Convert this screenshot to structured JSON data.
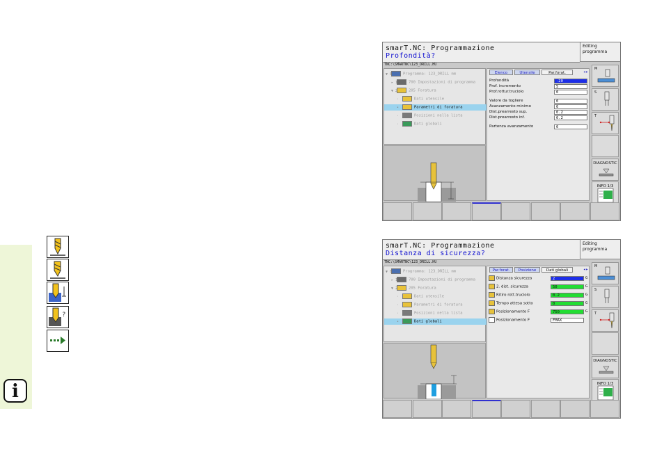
{
  "legend_icons": [
    {
      "name": "depth-drilling-icon"
    },
    {
      "name": "drill-icon"
    },
    {
      "name": "drill-feed-icon"
    },
    {
      "name": "drill-chip-icon"
    },
    {
      "name": "approach-arrow-icon"
    }
  ],
  "info_icon": {
    "glyph": "i"
  },
  "screens": [
    {
      "title": "smarT.NC: Programmazione",
      "subtitle": "Profondità?",
      "mode": [
        "Editing",
        "programma"
      ],
      "path": "TNC:\\SMARTNC\\123_DRILL.HU",
      "tree": [
        {
          "arrow": "▼ 0",
          "label": "Programma: 123_DRILL mm",
          "selected": false,
          "indent": 0
        },
        {
          "arrow": "▸ 1",
          "label": "700 Impostazioni di programma",
          "selected": false,
          "indent": 1
        },
        {
          "arrow": "▼ 2",
          "label": "205 Foratura",
          "selected": false,
          "indent": 1
        },
        {
          "arrow": "·",
          "label": "Dati utensile",
          "selected": false,
          "indent": 2
        },
        {
          "arrow": "•",
          "label": "Parametri di foratura",
          "selected": true,
          "indent": 2
        },
        {
          "arrow": "·",
          "label": "Posizioni nella lista",
          "selected": false,
          "indent": 2
        },
        {
          "arrow": "·",
          "label": "Dati globali",
          "selected": false,
          "indent": 2
        }
      ],
      "tabs": [
        {
          "label": "Elenco",
          "active": false
        },
        {
          "label": "Utensile",
          "active": false
        },
        {
          "label": "Par.forat.",
          "active": true
        }
      ],
      "fields": [
        {
          "label": "Profondità",
          "value": "-20",
          "highlight": true,
          "icon": false,
          "unit": ""
        },
        {
          "label": "Prof. incremento",
          "value": "5",
          "highlight": false,
          "icon": false,
          "unit": ""
        },
        {
          "label": "Prof.rottur.truciolo",
          "value": "0",
          "highlight": false,
          "icon": false,
          "unit": ""
        },
        {
          "label": "Valore da togliere",
          "value": "0",
          "highlight": false,
          "icon": false,
          "unit": ""
        },
        {
          "label": "Avanzamento minimo",
          "value": "0",
          "highlight": false,
          "icon": false,
          "unit": ""
        },
        {
          "label": "Dist.prearresto sup.",
          "value": "0.2",
          "highlight": false,
          "icon": false,
          "unit": ""
        },
        {
          "label": "Dist.prearresto inf.",
          "value": "0.2",
          "highlight": false,
          "icon": false,
          "unit": ""
        },
        {
          "label": "Partenza avanzamento",
          "value": "0",
          "highlight": false,
          "icon": false,
          "unit": ""
        }
      ],
      "softkeys": [
        {
          "label": "M"
        },
        {
          "label": "S"
        },
        {
          "label": "T"
        },
        {
          "label": ""
        },
        {
          "label": "DIAGNOSTIC"
        },
        {
          "label": "INFO 1/3"
        }
      ]
    },
    {
      "title": "smarT.NC: Programmazione",
      "subtitle": "Distanza di sicurezza?",
      "mode": [
        "Editing",
        "programma"
      ],
      "path": "TNC:\\SMARTNC\\123_DRILL.HU",
      "tree": [
        {
          "arrow": "▼ 0",
          "label": "Programma: 123_DRILL mm",
          "selected": false,
          "indent": 0
        },
        {
          "arrow": "▸ 1",
          "label": "700 Impostazioni di programma",
          "selected": false,
          "indent": 1
        },
        {
          "arrow": "▼ 2",
          "label": "205 Foratura",
          "selected": false,
          "indent": 1
        },
        {
          "arrow": "·",
          "label": "Dati utensile",
          "selected": false,
          "indent": 2
        },
        {
          "arrow": "·",
          "label": "Parametri di foratura",
          "selected": false,
          "indent": 2
        },
        {
          "arrow": "·",
          "label": "Posizioni nella lista",
          "selected": false,
          "indent": 2
        },
        {
          "arrow": "•",
          "label": "Dati globali",
          "selected": true,
          "indent": 2
        }
      ],
      "tabs": [
        {
          "label": "Par.forat.",
          "active": false
        },
        {
          "label": "Posizione",
          "active": false
        },
        {
          "label": "Dati globali",
          "active": true
        }
      ],
      "fields": [
        {
          "label": "Distanza sicurezza",
          "value": "2",
          "highlight": true,
          "icon": true,
          "unit": "G"
        },
        {
          "label": "2. dist. sicurezza",
          "value": "50",
          "highlight": false,
          "green": true,
          "icon": true,
          "unit": "G"
        },
        {
          "label": "Ritiro rott.truciolo",
          "value": "0.2",
          "highlight": false,
          "green": true,
          "icon": true,
          "unit": "G"
        },
        {
          "label": "Tempo attesa sotto",
          "value": "0",
          "highlight": false,
          "green": true,
          "icon": true,
          "unit": "G"
        },
        {
          "label": "Posizionamento F",
          "value": "750",
          "highlight": false,
          "green": true,
          "icon": true,
          "unit": "G"
        },
        {
          "label": "Posizionamento F",
          "value": "FMAX",
          "highlight": false,
          "icon": true,
          "unit": ""
        }
      ],
      "softkeys": [
        {
          "label": "M"
        },
        {
          "label": "S"
        },
        {
          "label": "T"
        },
        {
          "label": ""
        },
        {
          "label": "DIAGNOSTIC"
        },
        {
          "label": "INFO 1/3"
        }
      ]
    }
  ],
  "colors": {
    "highlight": "#1d2ee8",
    "green": "#22dd33",
    "selected_row": "#9ad3ee",
    "prompt": "#1010d0"
  }
}
